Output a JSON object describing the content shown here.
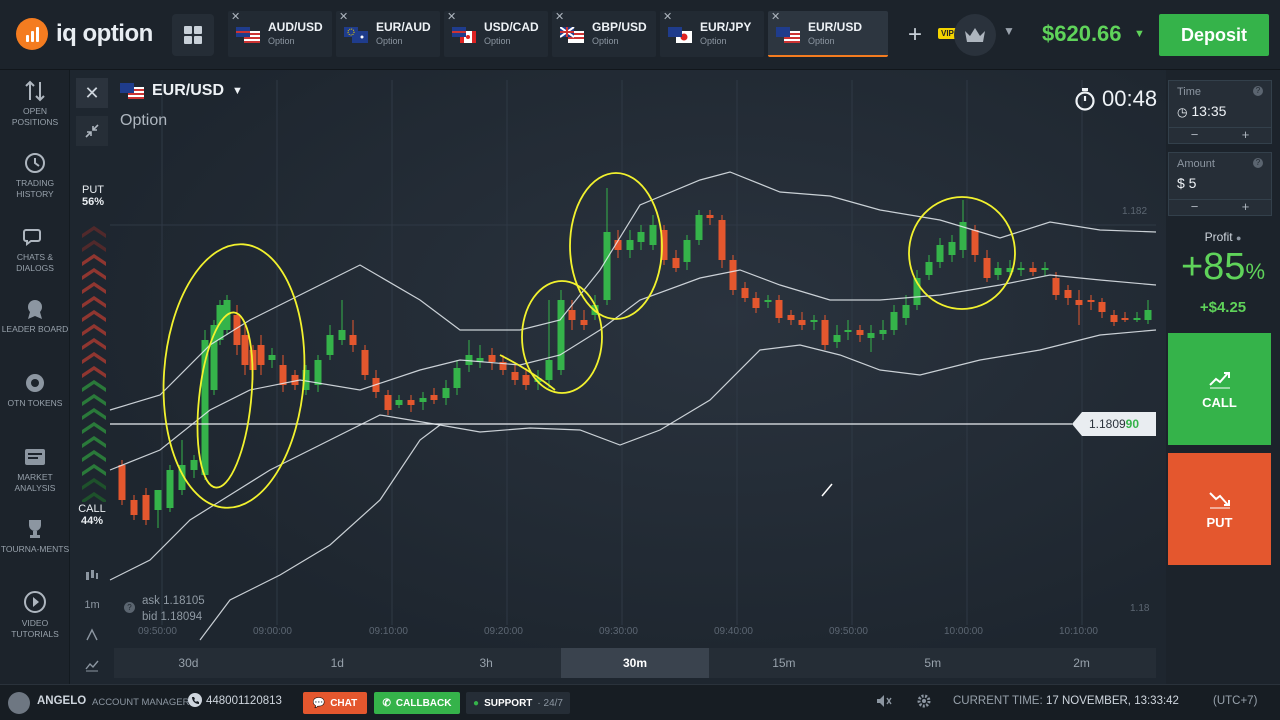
{
  "app": {
    "logo_text": "iq option",
    "balance": "$620.66",
    "deposit_label": "Deposit",
    "vip_label": "VIP"
  },
  "tabs": [
    {
      "pair": "AUD/USD",
      "kind": "Option",
      "flag": "au-us",
      "active": false
    },
    {
      "pair": "EUR/AUD",
      "kind": "Option",
      "flag": "eu-au",
      "active": false
    },
    {
      "pair": "USD/CAD",
      "kind": "Option",
      "flag": "us-ca",
      "active": false
    },
    {
      "pair": "GBP/USD",
      "kind": "Option",
      "flag": "gb-us",
      "active": false
    },
    {
      "pair": "EUR/JPY",
      "kind": "Option",
      "flag": "eu-jp",
      "active": false
    },
    {
      "pair": "EUR/USD",
      "kind": "Option",
      "flag": "eu-us",
      "active": true
    }
  ],
  "sidebar": [
    {
      "label": "OPEN POSITIONS",
      "icon": "arrows-updown-icon"
    },
    {
      "label": "TRADING HISTORY",
      "icon": "history-icon"
    },
    {
      "label": "CHATS & DIALOGS",
      "icon": "chat-icon"
    },
    {
      "label": "LEADER BOARD",
      "icon": "leaderboard-icon"
    },
    {
      "label": "OTN TOKENS",
      "icon": "token-icon"
    },
    {
      "label": "MARKET ANALYSIS",
      "icon": "analysis-icon"
    },
    {
      "label": "TOURNA-MENTS",
      "icon": "trophy-icon"
    },
    {
      "label": "VIDEO TUTORIALS",
      "icon": "play-icon"
    }
  ],
  "chart": {
    "pair": "EUR/USD",
    "subtitle": "Option",
    "timer": "00:48",
    "put_label": "PUT",
    "put_pct": "56%",
    "call_label": "CALL",
    "call_pct": "44%",
    "ask": "ask 1.18105",
    "bid": "bid 1.18094",
    "price_main": "1.1809",
    "price_tail": "90",
    "y_ticks": [
      "1.182",
      "1.18"
    ],
    "x_ticks": [
      "09:50:00",
      "09:00:00",
      "09:10:00",
      "09:20:00",
      "09:30:00",
      "09:40:00",
      "09:50:00",
      "10:00:00",
      "10:10:00"
    ],
    "mini_tools": [
      "1m"
    ]
  },
  "timeframes": [
    {
      "label": "30d",
      "active": false
    },
    {
      "label": "1d",
      "active": false
    },
    {
      "label": "3h",
      "active": false
    },
    {
      "label": "30m",
      "active": true
    },
    {
      "label": "15m",
      "active": false
    },
    {
      "label": "5m",
      "active": false
    },
    {
      "label": "2m",
      "active": false
    }
  ],
  "panel": {
    "time_label": "Time",
    "time_value": "13:35",
    "amount_label": "Amount",
    "amount_value": "$ 5",
    "minus": "−",
    "plus": "+",
    "profit_label": "Profit",
    "profit_pct": "+85",
    "profit_pct_sign": "%",
    "profit_amount": "+$4.25",
    "call_label": "CALL",
    "put_label": "PUT"
  },
  "footer": {
    "user": "ANGELO",
    "manager_label": "ACCOUNT MANAGER",
    "phone": "448001120813",
    "chat": "CHAT",
    "callback": "CALLBACK",
    "support": "SUPPORT",
    "support_hours": "24/7",
    "time_label": "CURRENT TIME:",
    "time_value": "17 NOVEMBER, 13:33:42",
    "tz": "(UTC+7)"
  },
  "colors": {
    "accent": "#f47c20",
    "up": "#35b34a",
    "down": "#e4572e",
    "annotation": "#f2f22e",
    "band": "#e8edf2"
  }
}
